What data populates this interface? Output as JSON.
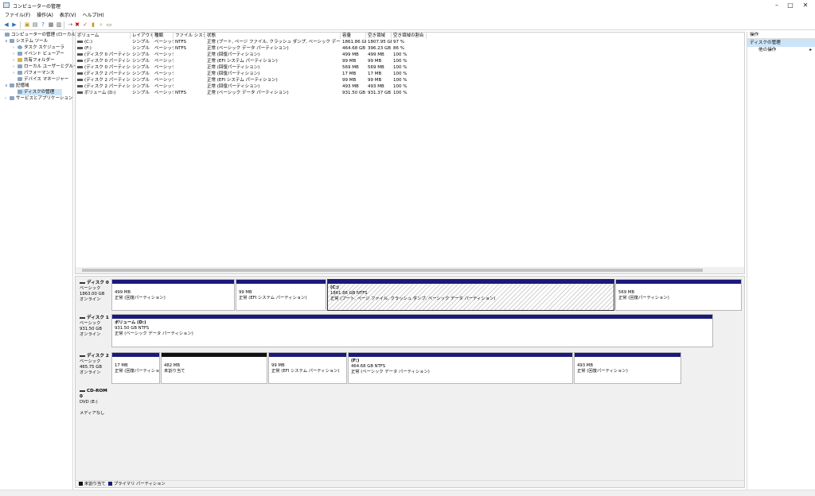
{
  "window": {
    "title": "コンピューターの管理"
  },
  "menu": [
    "ファイル(F)",
    "操作(A)",
    "表示(V)",
    "ヘルプ(H)"
  ],
  "tree": {
    "root": "コンピューターの管理 (ローカル)",
    "system_tools": "システム ツール",
    "task_scheduler": "タスク スケジューラ",
    "event_viewer": "イベント ビューアー",
    "shared_folders": "共有フォルダー",
    "local_users": "ローカル ユーザーとグループ",
    "performance": "パフォーマンス",
    "device_manager": "デバイス マネージャー",
    "storage": "記憶域",
    "disk_management": "ディスクの管理",
    "services": "サービスとアプリケーション"
  },
  "volume_table": {
    "headers": [
      "ボリューム",
      "レイアウト",
      "種類",
      "ファイル システム",
      "状態",
      "容量",
      "空き領域",
      "空き領域の割合"
    ],
    "rows": [
      [
        "(C:)",
        "シンプル",
        "ベーシック",
        "NTFS",
        "正常 (ブート, ページ ファイル, クラッシュ ダンプ, ベーシック データ パーティション)",
        "1861.86 GB",
        "1807.95 GB",
        "97 %"
      ],
      [
        "(F:)",
        "シンプル",
        "ベーシック",
        "NTFS",
        "正常 (ベーシック データ パーティション)",
        "464.68 GB",
        "396.23 GB",
        "86 %"
      ],
      [
        "(ディスク 0 パーティション 1)",
        "シンプル",
        "ベーシック",
        "",
        "正常 (回復パーティション)",
        "499 MB",
        "499 MB",
        "100 %"
      ],
      [
        "(ディスク 0 パーティション 2)",
        "シンプル",
        "ベーシック",
        "",
        "正常 (EFI システム パーティション)",
        "99 MB",
        "99 MB",
        "100 %"
      ],
      [
        "(ディスク 0 パーティション 5)",
        "シンプル",
        "ベーシック",
        "",
        "正常 (回復パーティション)",
        "569 MB",
        "569 MB",
        "100 %"
      ],
      [
        "(ディスク 2 パーティション 1)",
        "シンプル",
        "ベーシック",
        "",
        "正常 (回復パーティション)",
        "17 MB",
        "17 MB",
        "100 %"
      ],
      [
        "(ディスク 2 パーティション 2)",
        "シンプル",
        "ベーシック",
        "",
        "正常 (EFI システム パーティション)",
        "99 MB",
        "99 MB",
        "100 %"
      ],
      [
        "(ディスク 2 パーティション 5)",
        "シンプル",
        "ベーシック",
        "",
        "正常 (回復パーティション)",
        "493 MB",
        "493 MB",
        "100 %"
      ],
      [
        "ボリューム (D:)",
        "シンプル",
        "ベーシック",
        "NTFS",
        "正常 (ベーシック データ パーティション)",
        "931.50 GB",
        "931.37 GB",
        "100 %"
      ]
    ]
  },
  "disks": [
    {
      "name": "ディスク 0",
      "type": "ベーシック",
      "size": "1863.00 GB",
      "status": "オンライン",
      "parts": [
        {
          "l1": "",
          "l2": "499 MB",
          "l3": "正常 (回復パーティション)"
        },
        {
          "l1": "",
          "l2": "99 MB",
          "l3": "正常 (EFI システム パーティション)"
        },
        {
          "l1": "(C:)",
          "l2": "1861.86 GB NTFS",
          "l3": "正常 (ブート, ページ ファイル, クラッシュ ダンプ, ベーシック データ パーティション)"
        },
        {
          "l1": "",
          "l2": "569 MB",
          "l3": "正常 (回復パーティション)"
        }
      ]
    },
    {
      "name": "ディスク 1",
      "type": "ベーシック",
      "size": "931.50 GB",
      "status": "オンライン",
      "parts": [
        {
          "l1": "ボリューム (D:)",
          "l2": "931.50 GB NTFS",
          "l3": "正常 (ベーシック データ パーティション)"
        }
      ]
    },
    {
      "name": "ディスク 2",
      "type": "ベーシック",
      "size": "465.75 GB",
      "status": "オンライン",
      "parts": [
        {
          "l1": "",
          "l2": "17 MB",
          "l3": "正常 (回復パーティション)"
        },
        {
          "l1": "",
          "l2": "482 MB",
          "l3": "未割り当て"
        },
        {
          "l1": "",
          "l2": "99 MB",
          "l3": "正常 (EFI システム パーティション)"
        },
        {
          "l1": "(F:)",
          "l2": "464.68 GB NTFS",
          "l3": "正常 (ベーシック データ パーティション)"
        },
        {
          "l1": "",
          "l2": "493 MB",
          "l3": "正常 (回復パーティション)"
        }
      ]
    },
    {
      "name": "CD-ROM 0",
      "type": "DVD (E:)",
      "size": "",
      "status": "メディアなし",
      "parts": []
    }
  ],
  "legend": {
    "unallocated": "未割り当て",
    "primary": "プライマリ パーティション"
  },
  "actions": {
    "header": "操作",
    "selected": "ディスクの管理",
    "other": "他の操作"
  },
  "colors": {
    "primary_partition": "#1a1a7a",
    "unallocated": "#111111",
    "selection": "#cce4f7"
  }
}
